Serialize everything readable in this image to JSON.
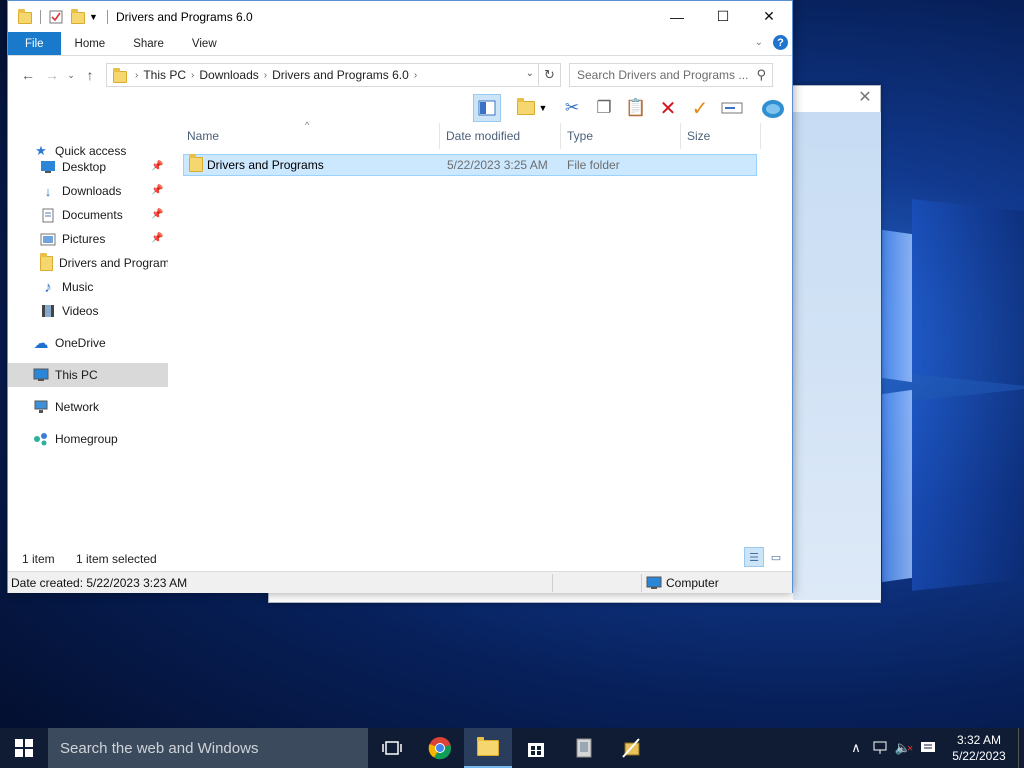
{
  "window": {
    "title": "Drivers and Programs 6.0",
    "minimize": "—",
    "maximize": "☐",
    "close": "✕"
  },
  "ribbon": {
    "tabs": [
      "File",
      "Home",
      "Share",
      "View"
    ],
    "help": "?"
  },
  "address": {
    "crumbs": [
      "This PC",
      "Downloads",
      "Drivers and Programs 6.0"
    ],
    "search_placeholder": "Search Drivers and Programs ..."
  },
  "navpane": {
    "quick_access": "Quick access",
    "items": [
      {
        "label": "Desktop",
        "icon": "desktop-icon",
        "pinned": true
      },
      {
        "label": "Downloads",
        "icon": "download-icon",
        "pinned": true
      },
      {
        "label": "Documents",
        "icon": "documents-icon",
        "pinned": true
      },
      {
        "label": "Pictures",
        "icon": "pictures-icon",
        "pinned": true
      },
      {
        "label": "Drivers and Programs",
        "icon": "folder-icon",
        "pinned": false
      },
      {
        "label": "Music",
        "icon": "music-icon",
        "pinned": false
      },
      {
        "label": "Videos",
        "icon": "videos-icon",
        "pinned": false
      }
    ],
    "onedrive": "OneDrive",
    "thispc": "This PC",
    "network": "Network",
    "homegroup": "Homegroup"
  },
  "columns": {
    "name": "Name",
    "date": "Date modified",
    "type": "Type",
    "size": "Size"
  },
  "files": [
    {
      "name": "Drivers and Programs",
      "date": "5/22/2023 3:25 AM",
      "type": "File folder",
      "size": ""
    }
  ],
  "status": {
    "count": "1 item",
    "selected": "1 item selected",
    "date_created": "Date created: 5/22/2023 3:23 AM",
    "location": "Computer"
  },
  "taskbar": {
    "search_placeholder": "Search the web and Windows",
    "time": "3:32 AM",
    "date": "5/22/2023"
  },
  "colors": {
    "accent": "#1979ca",
    "selection": "#cce8ff",
    "taskbar": "#0f1c34"
  }
}
